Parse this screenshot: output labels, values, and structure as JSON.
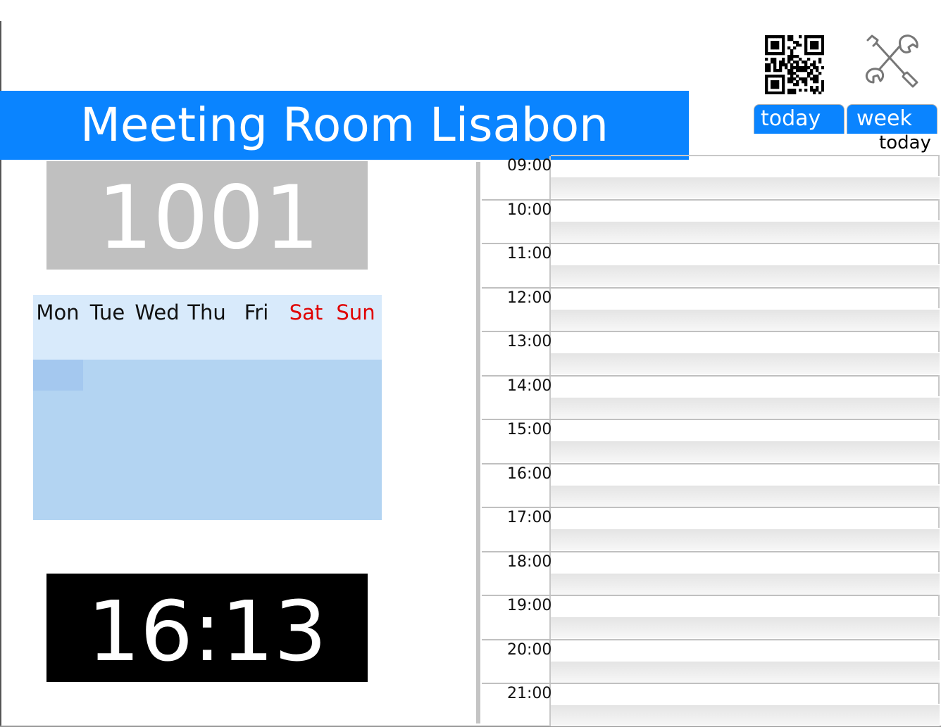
{
  "title": "Meeting Room Lisabon",
  "room_number": "1001",
  "weekdays": [
    {
      "label": "Mon",
      "weekend": false
    },
    {
      "label": "Tue",
      "weekend": false
    },
    {
      "label": "Wed",
      "weekend": false
    },
    {
      "label": "Thu",
      "weekend": false
    },
    {
      "label": "Fri",
      "weekend": false
    },
    {
      "label": "Sat",
      "weekend": true
    },
    {
      "label": "Sun",
      "weekend": true
    }
  ],
  "clock": "16:13",
  "tabs": {
    "today": "today",
    "week": "week"
  },
  "current_view": "today",
  "icons": {
    "qr": "qr-code-icon",
    "settings": "tools-icon"
  },
  "colors": {
    "accent": "#0a84ff",
    "weekend": "#e00000",
    "calendar": "#b3d4f2"
  },
  "schedule": {
    "hours": [
      "09:00",
      "10:00",
      "11:00",
      "12:00",
      "13:00",
      "14:00",
      "15:00",
      "16:00",
      "17:00",
      "18:00",
      "19:00",
      "20:00",
      "21:00"
    ]
  }
}
